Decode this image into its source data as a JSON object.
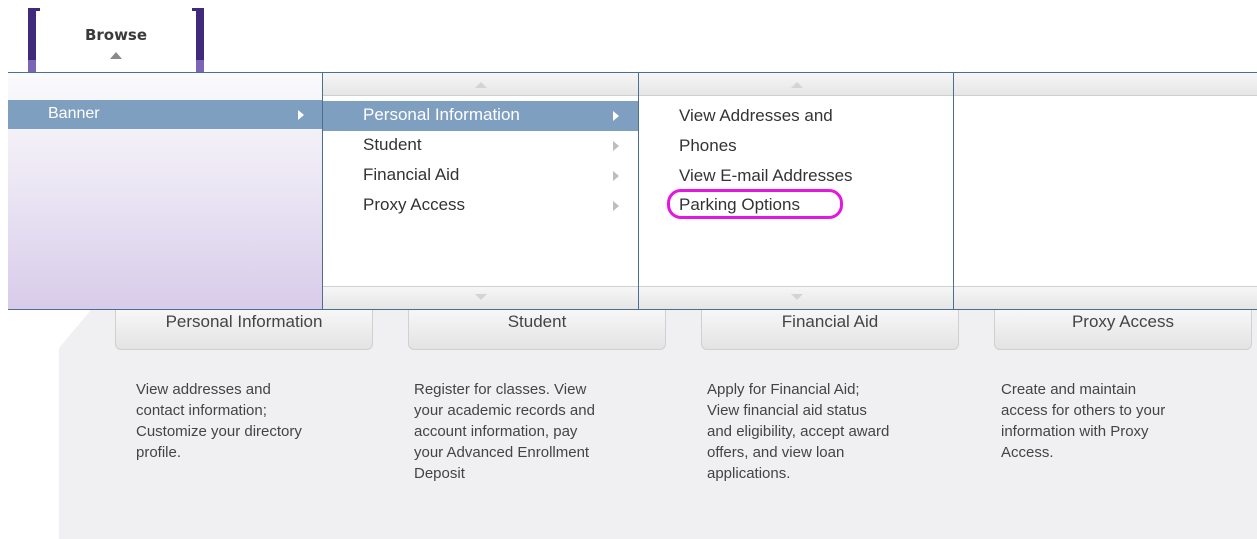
{
  "browse_tab": {
    "label": "Browse"
  },
  "menu": {
    "root": {
      "label": "Banner"
    },
    "categories": [
      {
        "label": "Personal Information"
      },
      {
        "label": "Student"
      },
      {
        "label": "Financial Aid"
      },
      {
        "label": "Proxy Access"
      }
    ],
    "personal_info_items": [
      {
        "label": "View Addresses and"
      },
      {
        "label": "Phones"
      },
      {
        "label": "View E-mail Addresses"
      },
      {
        "label": "Parking Options"
      }
    ]
  },
  "cards": [
    {
      "title": "Personal Information",
      "lines": [
        "View addresses and",
        "contact information;",
        "Customize your directory",
        "profile."
      ]
    },
    {
      "title": "Student",
      "lines": [
        "Register for classes. View",
        "your academic records and",
        "account information, pay",
        "your Advanced Enrollment",
        "Deposit"
      ]
    },
    {
      "title": "Financial Aid",
      "lines": [
        "Apply for Financial Aid;",
        "View financial aid status",
        "and eligibility, accept award",
        "offers, and view loan",
        "applications."
      ]
    },
    {
      "title": "Proxy Access",
      "lines": [
        "Create and maintain",
        "access for others to your",
        "information with Proxy",
        "Access."
      ]
    }
  ],
  "colors": {
    "selected_row": "#7f9fc0",
    "highlight_ring": "#e316e3",
    "tab_bracket": "#3f2a7c"
  }
}
